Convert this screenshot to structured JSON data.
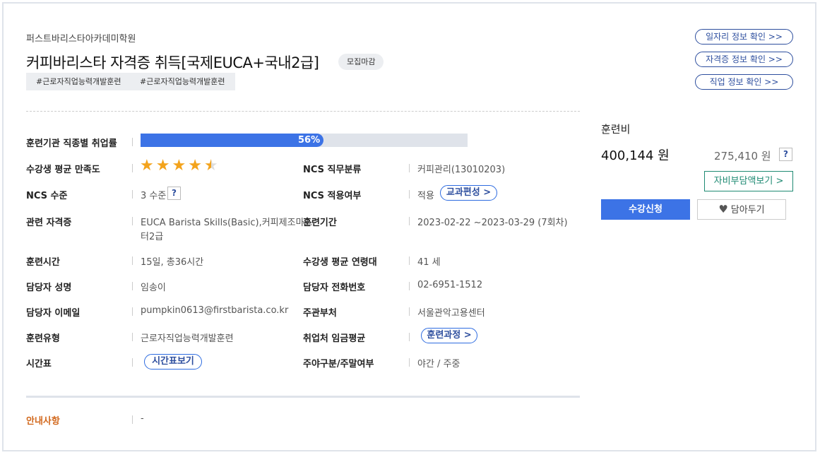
{
  "header": {
    "institution": "퍼스트바리스타아카데미학원",
    "title": "커피바리스타 자격증 취득[국제EUCA+국내2급]",
    "status_badge": "모집마감",
    "tags": [
      "#근로자직업능력개발훈련",
      "#근로자직업능력개발훈련"
    ]
  },
  "side_links": [
    "일자리 정보 확인 >>",
    "자격증 정보 확인 >>",
    "직업 정보 확인 >>"
  ],
  "details": {
    "employment_rate_label": "훈련기관 직종별 취업률",
    "employment_rate_value": "56%",
    "employment_rate_fraction": 0.56,
    "satisfaction_label": "수강생 평균 만족도",
    "satisfaction_stars": 4.5,
    "ncs_category_label": "NCS 직무분류",
    "ncs_category_value": "커피관리(13010203)",
    "ncs_level_label": "NCS 수준",
    "ncs_level_value": "3 수준",
    "ncs_apply_label": "NCS 적용여부",
    "ncs_apply_value": "적용",
    "curriculum_btn": "교과편성 >",
    "cert_label": "관련 자격증",
    "cert_value_line1": "EUCA Barista Skills(Basic),커피제조마스",
    "cert_value_line2": "터2급",
    "period_label": "훈련기간",
    "period_value": "2023-02-22 ~2023-03-29 (7회차)",
    "hours_label": "훈련시간",
    "hours_value": "15일, 총36시간",
    "age_label": "수강생 평균 연령대",
    "age_value": "41 세",
    "manager_label": "담당자 성명",
    "manager_value": "임송이",
    "phone_label": "담당자 전화번호",
    "phone_value": "02-6951-1512",
    "email_label": "담당자 이메일",
    "email_value": "pumpkin0613@firstbarista.co.kr",
    "dept_label": "주관부처",
    "dept_value": "서울관악고용센터",
    "type_label": "훈련유형",
    "type_value": "근로자직업능력개발훈련",
    "wage_label": "취업처 임금평균",
    "course_btn": "훈련과정 >",
    "timetable_label": "시간표",
    "timetable_btn": "시간표보기",
    "daynight_label": "주야구분/주말여부",
    "daynight_value": "야간 / 주중",
    "notice_label": "안내사항",
    "notice_value": "-",
    "help_mark": "?"
  },
  "fee": {
    "label": "훈련비",
    "total": "400,144 원",
    "self_pay": "275,410 원",
    "help_mark": "?",
    "self_pay_btn": "자비부담액보기 >",
    "apply_btn": "수강신청",
    "wish_btn": "담아두기"
  },
  "colors": {
    "accent_blue": "#3c73e6",
    "star": "#f3a31c",
    "notice": "#d2691e",
    "teal": "#1f8a73"
  }
}
